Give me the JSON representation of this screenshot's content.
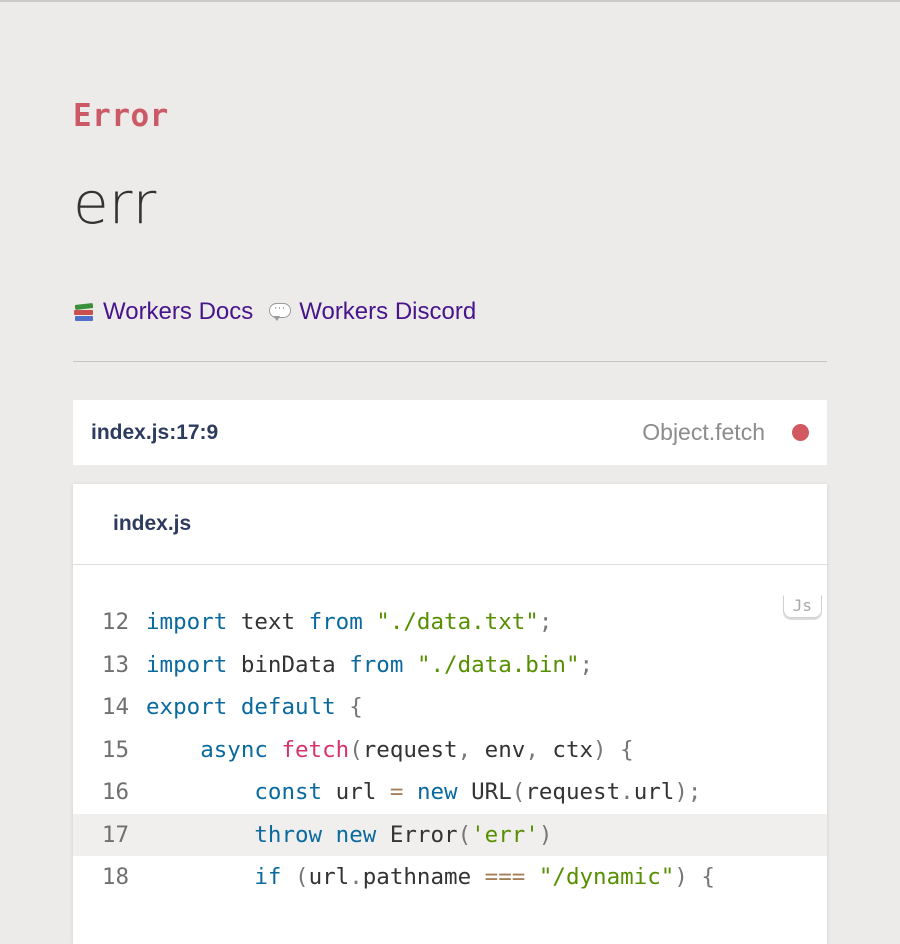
{
  "error": {
    "type": "Error",
    "message": "err"
  },
  "links": [
    {
      "icon": "books-icon",
      "label": "Workers Docs"
    },
    {
      "icon": "speech-balloon-icon",
      "label": "Workers Discord"
    }
  ],
  "frame": {
    "location": "index.js:17:9",
    "function": "Object.fetch",
    "status_color": "#d15a62"
  },
  "code_panel": {
    "filename": "index.js",
    "language_badge": "Js",
    "highlighted_line": 17,
    "lines": [
      {
        "number": "12",
        "text": "import text from \"./data.txt\";"
      },
      {
        "number": "13",
        "text": "import binData from \"./data.bin\";"
      },
      {
        "number": "14",
        "text": "export default {"
      },
      {
        "number": "15",
        "text": "    async fetch(request, env, ctx) {"
      },
      {
        "number": "16",
        "text": "        const url = new URL(request.url);"
      },
      {
        "number": "17",
        "text": "        throw new Error('err')"
      },
      {
        "number": "18",
        "text": "        if (url.pathname === \"/dynamic\") {"
      }
    ]
  },
  "colors": {
    "background": "#edebe9",
    "error_type": "#cc5a66",
    "link": "#47148c",
    "keyword": "#0a6a9e",
    "string": "#568f00",
    "function": "#d6336c"
  }
}
